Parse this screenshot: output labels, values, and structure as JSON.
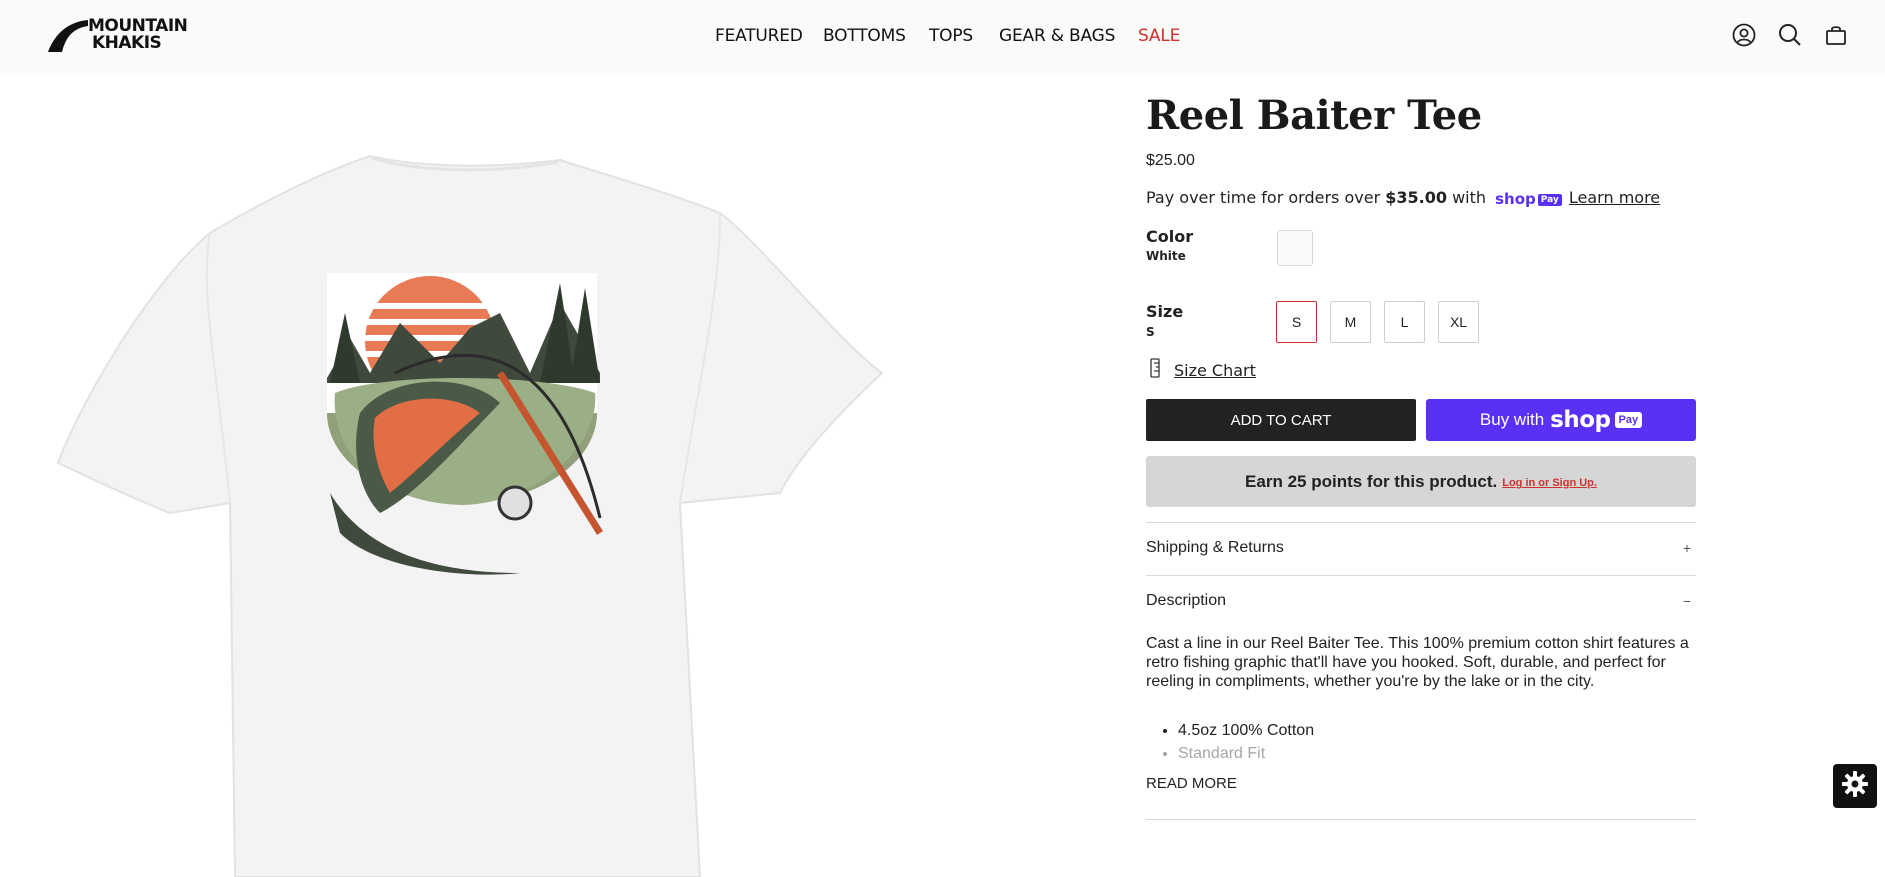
{
  "header": {
    "logo_line1": "MOUNTAIN",
    "logo_line2": "KHAKIS",
    "nav": [
      {
        "label": "FEATURED"
      },
      {
        "label": "BOTTOMS"
      },
      {
        "label": "TOPS"
      },
      {
        "label": "GEAR & BAGS"
      },
      {
        "label": "SALE"
      }
    ],
    "icons": [
      "account-icon",
      "search-icon",
      "cart-icon"
    ],
    "sale_color": "#d0312d"
  },
  "product": {
    "title": "Reel Baiter Tee",
    "price": "$25.00",
    "installments": {
      "prefix": "Pay over time for orders over ",
      "amount": "$35.00",
      "middle": " with ",
      "shop_badge": "shop",
      "pay_badge": "Pay",
      "learn_more": "Learn more"
    },
    "color": {
      "label": "Color",
      "value": "White"
    },
    "size": {
      "label": "Size",
      "value": "S",
      "options": [
        "S",
        "M",
        "L",
        "XL"
      ],
      "selected": "S"
    },
    "size_chart": "Size Chart",
    "add_to_cart": "ADD TO CART",
    "buy_with": "Buy with",
    "buy_shop": "shop",
    "buy_pay": "Pay",
    "points": {
      "text": "Earn 25 points for this product.",
      "link": "Log in or Sign Up."
    },
    "accordions": [
      {
        "label": "Shipping & Returns",
        "icon": "+"
      },
      {
        "label": "Description",
        "icon": "−"
      }
    ],
    "description": "Cast a line in our Reel Baiter Tee. This 100% premium cotton shirt features a retro fishing graphic that'll have you hooked. Soft, durable, and perfect for reeling in compliments, whether you're by the lake or in the city.",
    "bullets": [
      "4.5oz 100% Cotton",
      "Standard Fit"
    ],
    "read_more": "READ MORE"
  },
  "colors": {
    "accent_red": "#d0312d",
    "shop_pay_purple": "#5a31f4",
    "button_dark": "#222222"
  }
}
